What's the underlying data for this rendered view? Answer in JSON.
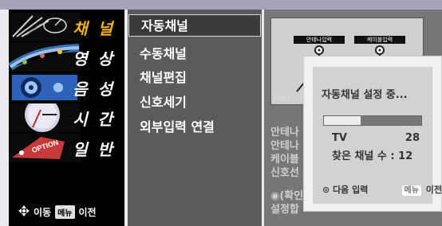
{
  "categories": [
    {
      "label": "채 널",
      "active": true
    },
    {
      "label": "영 상",
      "active": false
    },
    {
      "label": "음 성",
      "active": false
    },
    {
      "label": "시 간",
      "active": false
    },
    {
      "label": "일 반",
      "active": false
    }
  ],
  "thumb_text": {
    "option": "OPTION"
  },
  "sidebar_footer": {
    "move_label": "이동",
    "menu_tag": "메뉴",
    "prev_label": "이전"
  },
  "submenu": {
    "items": [
      {
        "label": "자동채널",
        "active": true
      },
      {
        "label": "수동채널",
        "active": false
      },
      {
        "label": "채널편집",
        "active": false
      },
      {
        "label": "신호세기",
        "active": false
      },
      {
        "label": "외부입력 연결",
        "active": false
      }
    ]
  },
  "diagram": {
    "port_antenna": "안테나입력",
    "port_cable": "케이블입력",
    "caption": "안테나"
  },
  "background_text": [
    "안테나",
    "안테나",
    "케이블",
    "신호선",
    "◉(확인",
    "설정합"
  ],
  "dialog": {
    "title": "자동채널 설정 중...",
    "progress_percent": 38,
    "band": "TV",
    "channel": "28",
    "found_label": "찾은 채널 수 : 12",
    "next_label": "다음 입력",
    "menu_tag": "메뉴",
    "prev_label": "이전"
  },
  "colors": {
    "active_category": "#f5b21b",
    "sidebar_bg": "#000000",
    "submenu_bg": "#5b5b5b",
    "right_panel_bg": "#777777",
    "dialog_bg": "#d2d2d2"
  }
}
